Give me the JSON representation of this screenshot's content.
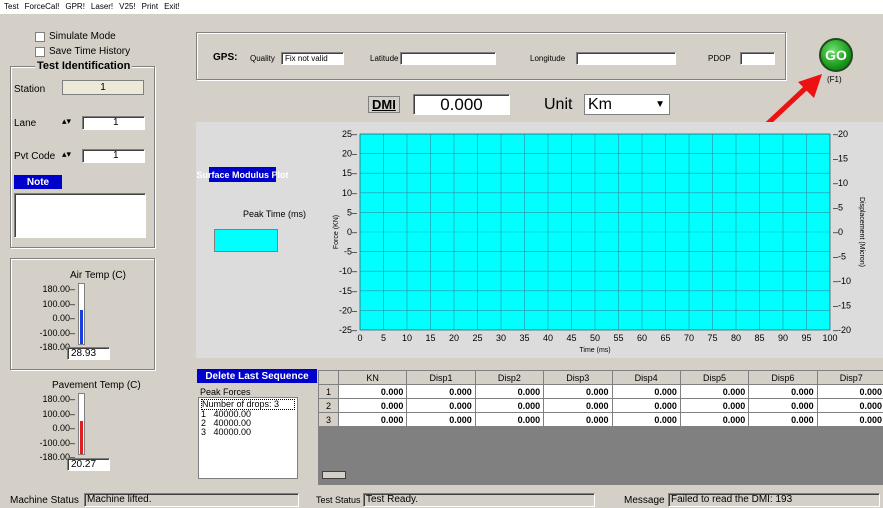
{
  "menu": [
    "Test",
    "ForceCal!",
    "GPR!",
    "Laser!",
    "V25!",
    "Print",
    "Exit!"
  ],
  "options": {
    "simulate": "Simulate Mode",
    "save_history": "Save Time History"
  },
  "test_id": {
    "title": "Test Identification",
    "station_label": "Station",
    "station_value": "1",
    "lane_label": "Lane",
    "lane_value": "1",
    "pvt_label": "Pvt Code",
    "pvt_value": "1",
    "note_label": "Note"
  },
  "air": {
    "title": "Air Temp (C)",
    "ticks": [
      "180.00",
      "100.00",
      "0.00",
      "-100.00",
      "-180.00"
    ],
    "value": "28.93",
    "level": 0.5693
  },
  "pave": {
    "title": "Pavement Temp (C)",
    "ticks": [
      "180.00",
      "100.00",
      "0.00",
      "-100.00",
      "-180.00"
    ],
    "value": "20.27",
    "level": 0.5536
  },
  "gps": {
    "label": "GPS:",
    "quality_label": "Quality",
    "quality_value": "Fix not valid",
    "lat_label": "Latitude",
    "lat_value": "",
    "lon_label": "Longitude",
    "lon_value": "",
    "pdop_label": "PDOP",
    "pdop_value": ""
  },
  "go": {
    "label": "GO",
    "hotkey": "(F1)"
  },
  "dmi": {
    "label": "DMI",
    "value": "0.000",
    "unit_label": "Unit",
    "unit_value": "Km"
  },
  "plot_panel": {
    "surface_modulus": "Surface Modulus Plot",
    "peak_time_label": "Peak Time (ms)",
    "peak_time_value": ""
  },
  "chart_data": {
    "type": "line",
    "xlabel": "Time (ms)",
    "ylabel": "Force (KN)",
    "y2label": "Displacement (Micron)",
    "xlim": [
      0,
      100
    ],
    "ylim": [
      -25,
      25
    ],
    "y2lim": [
      -20,
      20
    ],
    "x_ticks": [
      "0",
      "5",
      "10",
      "15",
      "20",
      "25",
      "30",
      "35",
      "40",
      "45",
      "50",
      "55",
      "60",
      "65",
      "70",
      "75",
      "80",
      "85",
      "90",
      "95",
      "100"
    ],
    "y_ticks": [
      "25",
      "20",
      "15",
      "10",
      "5",
      "0",
      "-5",
      "-10",
      "-15",
      "-20",
      "-25"
    ],
    "y2_ticks": [
      "20",
      "15",
      "10",
      "5",
      "0",
      "-5",
      "-10",
      "-15",
      "-20"
    ],
    "background": "#00ffff",
    "grid": true,
    "series": []
  },
  "sequence": {
    "delete_label": "Delete Last Sequence",
    "peak_forces_label": "Peak Forces",
    "drops_label": "Number of drops: 3",
    "drops": [
      "1   40000.00",
      "2   40000.00",
      "3   40000.00"
    ]
  },
  "table": {
    "columns": [
      "KN",
      "Disp1",
      "Disp2",
      "Disp3",
      "Disp4",
      "Disp5",
      "Disp6",
      "Disp7"
    ],
    "rows": [
      {
        "n": "1",
        "cells": [
          "0.000",
          "0.000",
          "0.000",
          "0.000",
          "0.000",
          "0.000",
          "0.000",
          "0.000"
        ]
      },
      {
        "n": "2",
        "cells": [
          "0.000",
          "0.000",
          "0.000",
          "0.000",
          "0.000",
          "0.000",
          "0.000",
          "0.000"
        ]
      },
      {
        "n": "3",
        "cells": [
          "0.000",
          "0.000",
          "0.000",
          "0.000",
          "0.000",
          "0.000",
          "0.000",
          "0.000"
        ]
      }
    ]
  },
  "status": {
    "machine_label": "Machine Status",
    "machine_value": "Machine lifted.",
    "test_label": "Test Status",
    "test_value": "Test Ready.",
    "message_label": "Message",
    "message_value": "Failed to read the DMI: 193"
  },
  "colors": {
    "accent_blue": "#0000cc",
    "plot_bg": "#00ffff",
    "go_green": "#1a9a1a",
    "arrow_red": "#ee1111",
    "air_bar": "#1a3fe0",
    "pave_bar": "#e02020"
  }
}
